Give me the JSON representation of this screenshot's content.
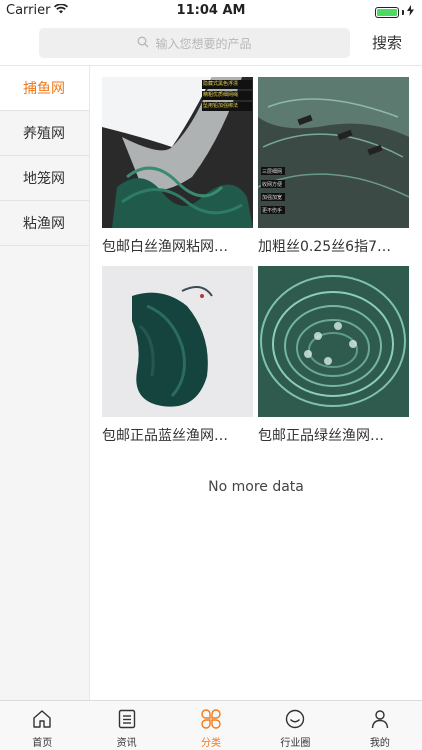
{
  "status_bar": {
    "carrier": "Carrier",
    "time": "11:04 AM",
    "battery_level": 1.0
  },
  "search": {
    "placeholder": "输入您想要的产品",
    "button_label": "搜索"
  },
  "sidebar": {
    "items": [
      {
        "label": "捕鱼网",
        "active": true
      },
      {
        "label": "养殖网",
        "active": false
      },
      {
        "label": "地笼网",
        "active": false
      },
      {
        "label": "粘渔网",
        "active": false
      }
    ]
  },
  "products": [
    {
      "title": "包邮白丝渔网粘网…",
      "image_overlay": [
        "隐藏式黑色浮漂",
        "精粗优质细网绳",
        "坠用铅加强绑法"
      ]
    },
    {
      "title": "加粗丝0.25丝6指7…",
      "image_overlay": [
        "三层细网",
        "收网方便",
        "加强加宽",
        "更不伤手"
      ]
    },
    {
      "title": "包邮正品蓝丝渔网…",
      "image_overlay": []
    },
    {
      "title": "包邮正品绿丝渔网…",
      "image_overlay": []
    }
  ],
  "footer_text": "No more data",
  "tab_bar": {
    "items": [
      {
        "label": "首页",
        "icon": "home-icon",
        "active": false
      },
      {
        "label": "资讯",
        "icon": "news-icon",
        "active": false
      },
      {
        "label": "分类",
        "icon": "category-icon",
        "active": true
      },
      {
        "label": "行业圈",
        "icon": "circle-icon",
        "active": false
      },
      {
        "label": "我的",
        "icon": "profile-icon",
        "active": false
      }
    ]
  },
  "colors": {
    "accent": "#f07a1c",
    "sidebar_bg": "#f5f5f5",
    "search_bg": "#efefef",
    "battery": "#4cd964"
  }
}
